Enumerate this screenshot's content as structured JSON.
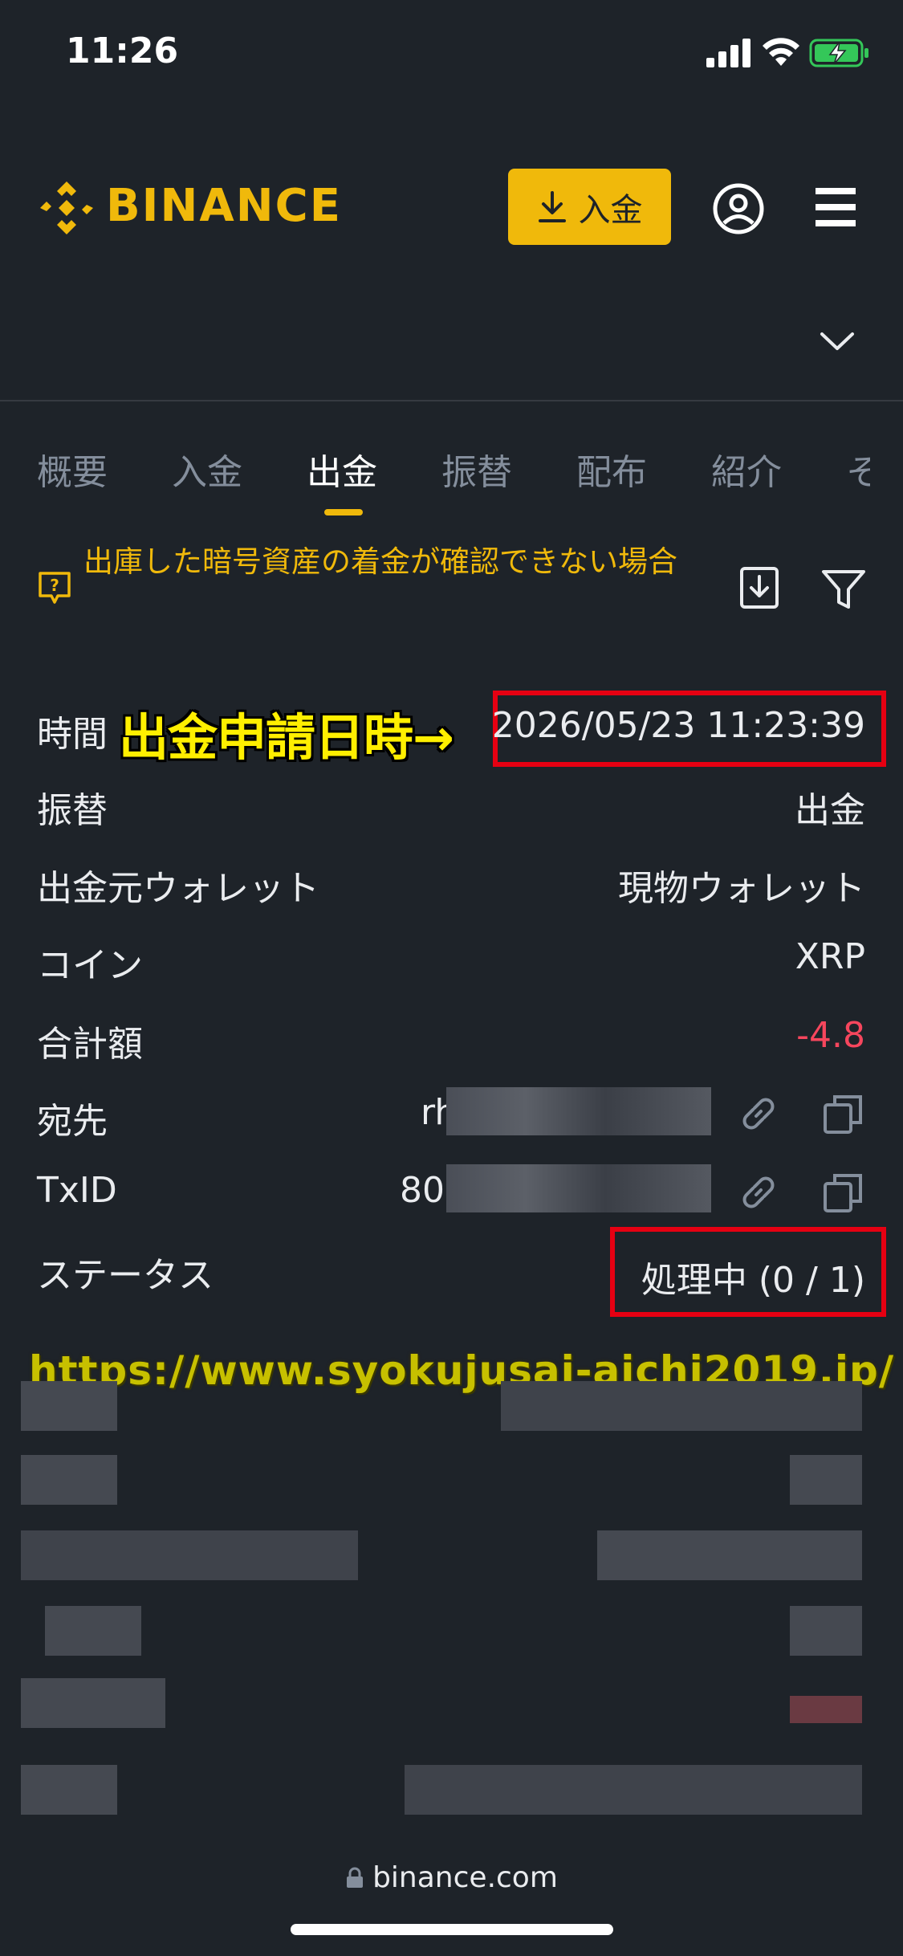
{
  "status_bar": {
    "time": "11:26"
  },
  "header": {
    "brand": "BINANCE",
    "deposit_label": "入金"
  },
  "tabs": [
    {
      "label": "概要"
    },
    {
      "label": "入金"
    },
    {
      "label": "出金",
      "active": true
    },
    {
      "label": "振替"
    },
    {
      "label": "配布"
    },
    {
      "label": "紹介"
    },
    {
      "label": "そ"
    }
  ],
  "notice": {
    "text": "出庫した暗号資産の着金が確認できない場合"
  },
  "details": {
    "time_label": "時間",
    "time_value": "2026/05/23 11:23:39",
    "annotation": "出金申請日時→",
    "transfer_label": "振替",
    "transfer_value": "出金",
    "source_wallet_label": "出金元ウォレット",
    "source_wallet_value": "現物ウォレット",
    "coin_label": "コイン",
    "coin_value": "XRP",
    "amount_label": "合計額",
    "amount_value": "-4.8",
    "address_label": "宛先",
    "address_value": "rh",
    "txid_label": "TxID",
    "txid_value": "800",
    "status_label": "ステータス",
    "status_value": "処理中 (0 / 1)"
  },
  "watermark": "https://www.syokujusai-aichi2019.jp/",
  "browser": {
    "url": "binance.com"
  },
  "colors": {
    "accent": "#f0b90b",
    "negative": "#f6465d",
    "highlight": "#e60012",
    "background": "#1e2329"
  }
}
